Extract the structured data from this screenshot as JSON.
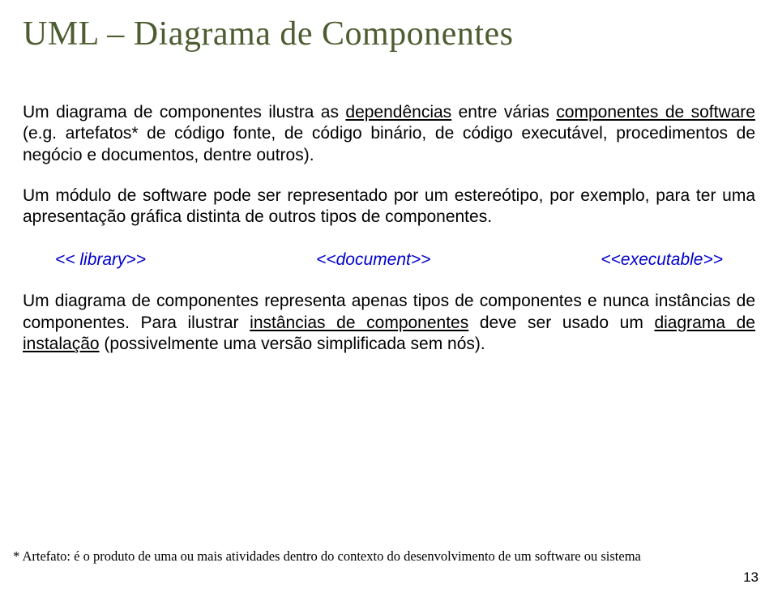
{
  "title": "UML – Diagrama de Componentes",
  "para1_pre": "Um diagrama de componentes ilustra as ",
  "para1_dep": "dependências",
  "para1_mid": " entre várias ",
  "para1_comp": "componentes de software",
  "para1_post": " (e.g. artefatos* de código fonte, de código binário, de código executável, procedimentos de negócio e documentos, dentre outros).",
  "para2": "Um módulo de software pode ser representado por um estereótipo, por exemplo, para ter uma apresentação gráfica distinta de outros tipos de componentes.",
  "stereotypes": {
    "s1": "<< library>>",
    "s2": "<<document>>",
    "s3": "<<executable>>"
  },
  "para3_pre": "Um diagrama de componentes representa apenas tipos de componentes e nunca instâncias de componentes. Para ilustrar ",
  "para3_u1": "instâncias de componentes",
  "para3_mid": " deve ser usado um ",
  "para3_u2": "diagrama de instalação",
  "para3_post": " (possivelmente uma versão simplificada sem nós).",
  "footnote_label": "* Artefato:",
  "footnote_text": "  é o produto de uma ou mais atividades dentro do contexto do desenvolvimento de um software ou sistema",
  "page_number": "13"
}
